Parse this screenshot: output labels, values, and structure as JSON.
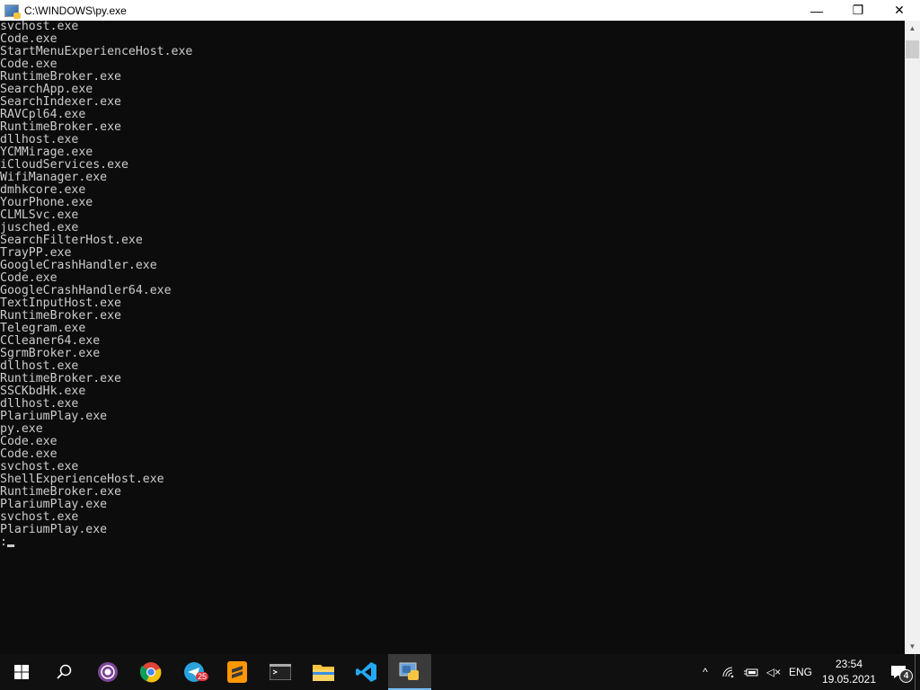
{
  "window": {
    "title": "C:\\WINDOWS\\py.exe",
    "minimize": "—",
    "restore": "❐",
    "close": "✕"
  },
  "console": {
    "lines": [
      "svchost.exe",
      "Code.exe",
      "StartMenuExperienceHost.exe",
      "Code.exe",
      "RuntimeBroker.exe",
      "SearchApp.exe",
      "SearchIndexer.exe",
      "RAVCpl64.exe",
      "RuntimeBroker.exe",
      "dllhost.exe",
      "YCMMirage.exe",
      "iCloudServices.exe",
      "WifiManager.exe",
      "dmhkcore.exe",
      "YourPhone.exe",
      "CLMLSvc.exe",
      "jusched.exe",
      "SearchFilterHost.exe",
      "TrayPP.exe",
      "GoogleCrashHandler.exe",
      "Code.exe",
      "GoogleCrashHandler64.exe",
      "TextInputHost.exe",
      "RuntimeBroker.exe",
      "Telegram.exe",
      "CCleaner64.exe",
      "SgrmBroker.exe",
      "dllhost.exe",
      "RuntimeBroker.exe",
      "SSCKbdHk.exe",
      "dllhost.exe",
      "PlariumPlay.exe",
      "py.exe",
      "Code.exe",
      "Code.exe",
      "svchost.exe",
      "ShellExperienceHost.exe",
      "RuntimeBroker.exe",
      "PlariumPlay.exe",
      "svchost.exe",
      "PlariumPlay.exe"
    ],
    "prompt": ":"
  },
  "taskbar": {
    "telegram_badge": "25",
    "language": "ENG",
    "time": "23:54",
    "date": "19.05.2021",
    "notifications": "4"
  }
}
